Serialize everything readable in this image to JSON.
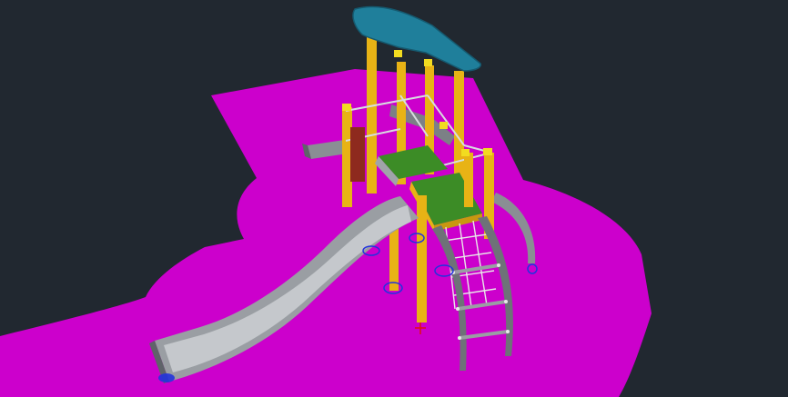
{
  "viewport": {
    "background": "#212830"
  },
  "colors": {
    "ground_surface": "#CC00CC",
    "roof": "#1F7F9B",
    "post": "#E8B315",
    "post_cap": "#F2DC20",
    "deck": "#3C8C26",
    "slide_metal": "#9A9EA3",
    "rail_metal": "#7A7E84",
    "panel_red": "#8E2A1E",
    "anchor_ring": "#2233DD",
    "origin_marker": "#E01010"
  },
  "scene": {
    "object_icon": "playground-structure-icon",
    "parts": [
      "ground-surface",
      "roof-canopy",
      "support-posts",
      "deck-platform",
      "slide",
      "climbing-net",
      "arch-ladder",
      "side-arch",
      "crawl-tunnel",
      "railings",
      "anchor-rings"
    ]
  }
}
